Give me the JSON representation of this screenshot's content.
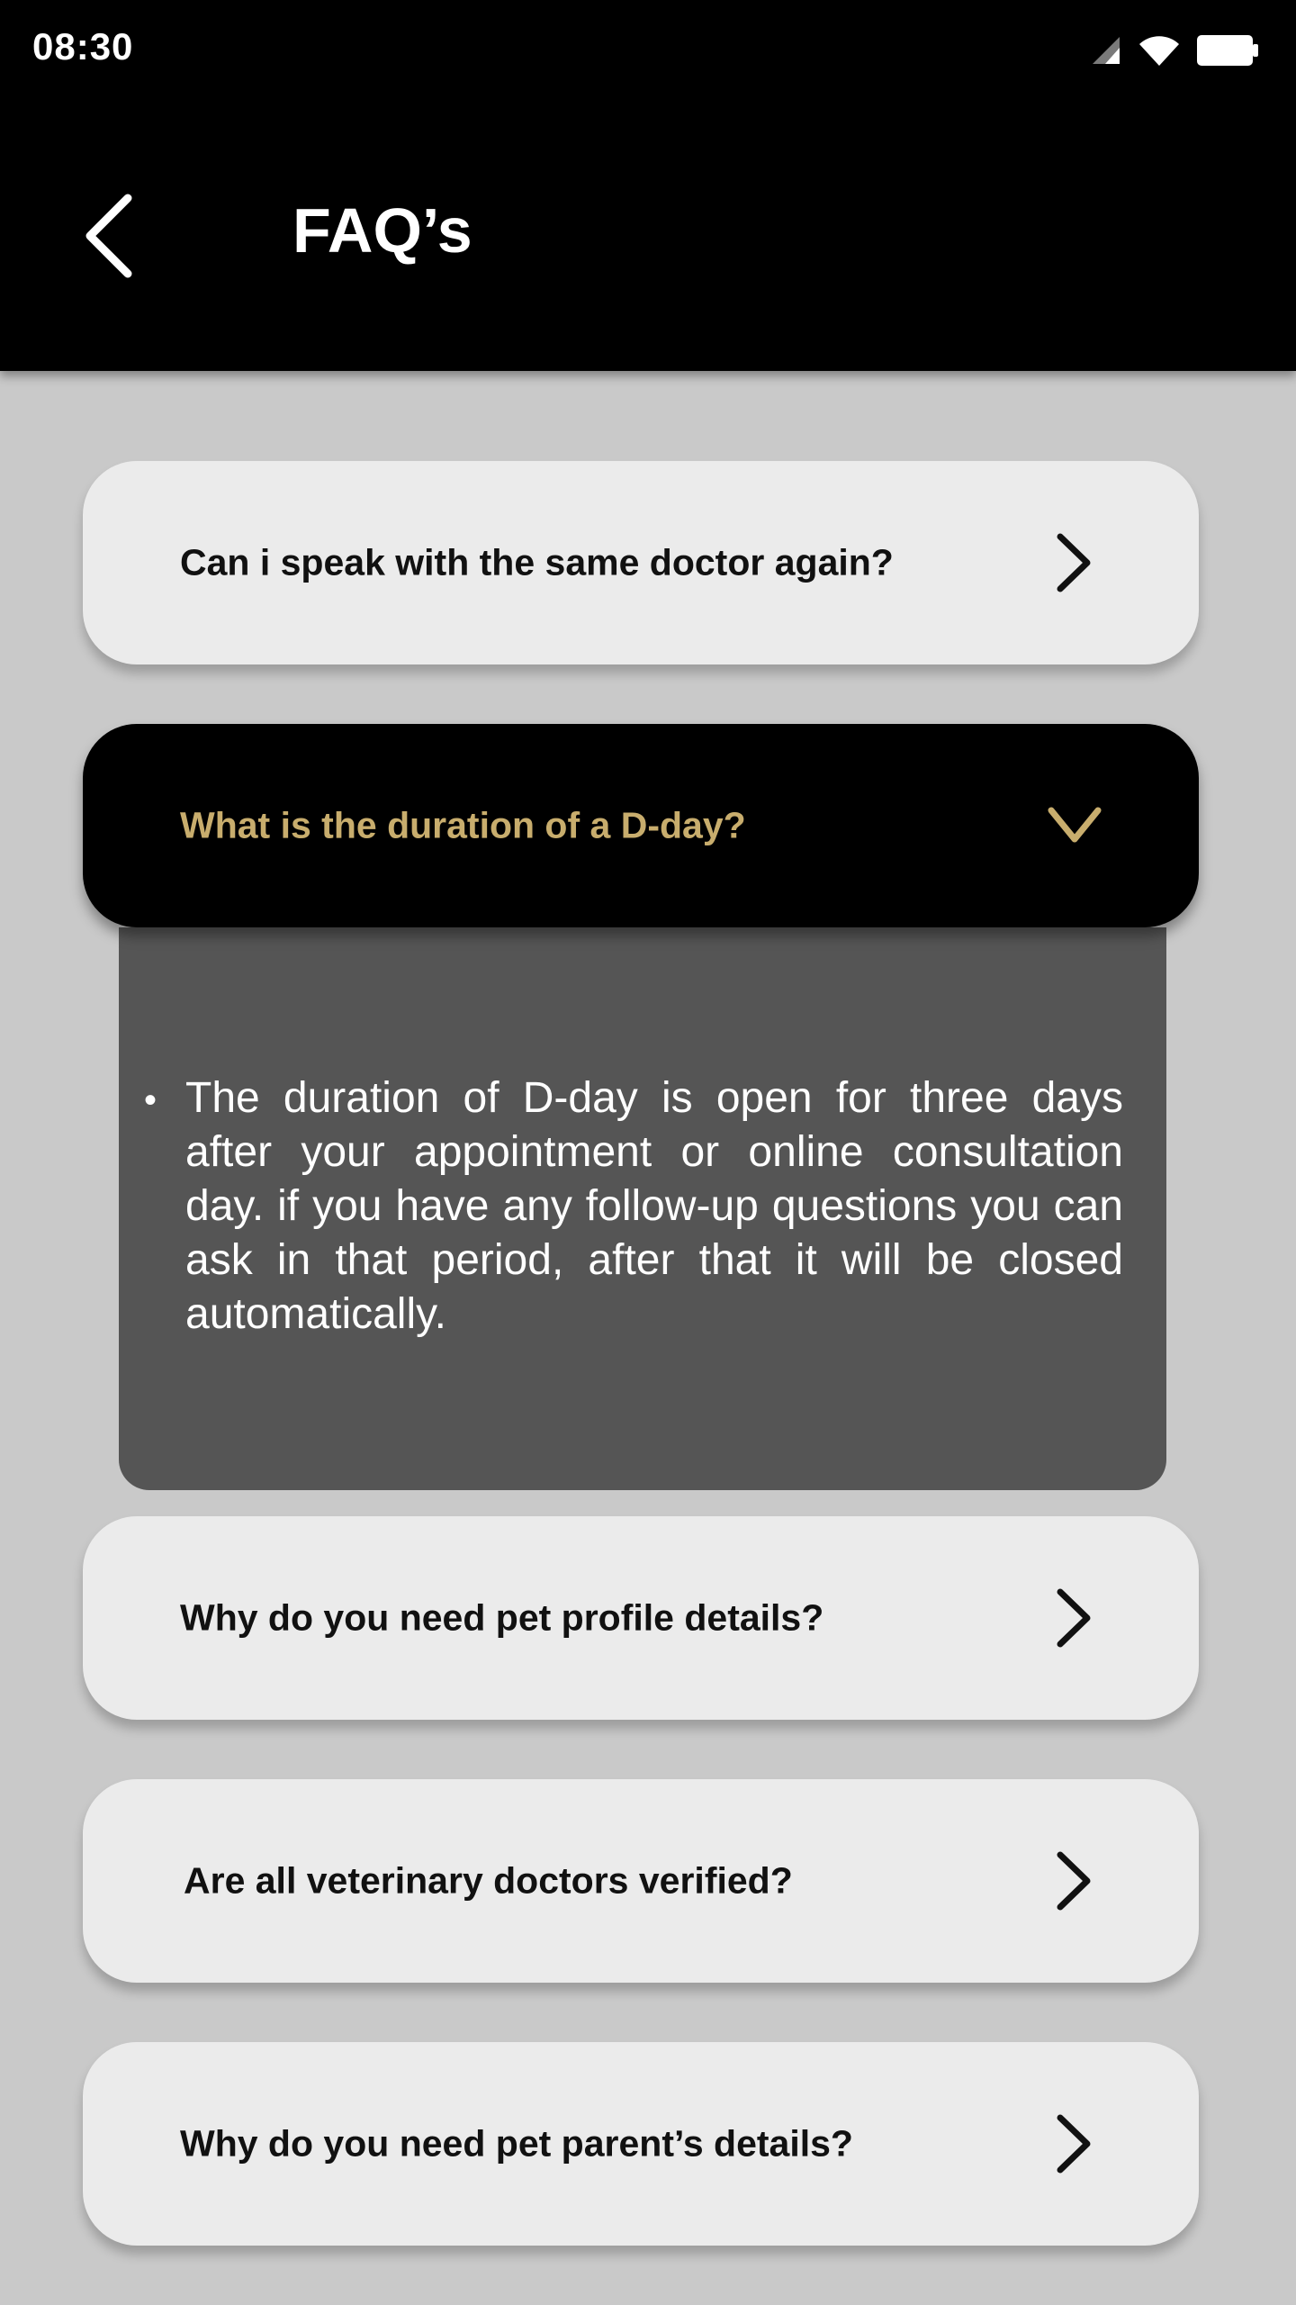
{
  "status_bar": {
    "time": "08:30",
    "icons": [
      "signal-icon",
      "wifi-icon",
      "battery-icon"
    ]
  },
  "header": {
    "title": "FAQ’s",
    "back_icon": "chevron-left-icon"
  },
  "faqs": [
    {
      "question": "Can i speak with the same doctor again?",
      "expanded": false,
      "icon": "chevron-right-icon"
    },
    {
      "question": "What is the duration of a D-day?",
      "expanded": true,
      "icon": "chevron-down-icon",
      "answer": "The duration of D-day is open for three days after your appointment or online consultation day. if you have any follow-up questions you can ask in that period, after that it will be closed automatically."
    },
    {
      "question": "Why do you need pet profile details?",
      "expanded": false,
      "icon": "chevron-right-icon"
    },
    {
      "question": "Are all veterinary doctors verified?",
      "expanded": false,
      "icon": "chevron-right-icon"
    },
    {
      "question": "Why do you need pet parent’s details?",
      "expanded": false,
      "icon": "chevron-right-icon"
    }
  ],
  "colors": {
    "background": "#c9c9c9",
    "card": "#ebebeb",
    "active_card": "#000000",
    "accent_gold": "#c8ad6d",
    "answer_panel": "#555555"
  }
}
